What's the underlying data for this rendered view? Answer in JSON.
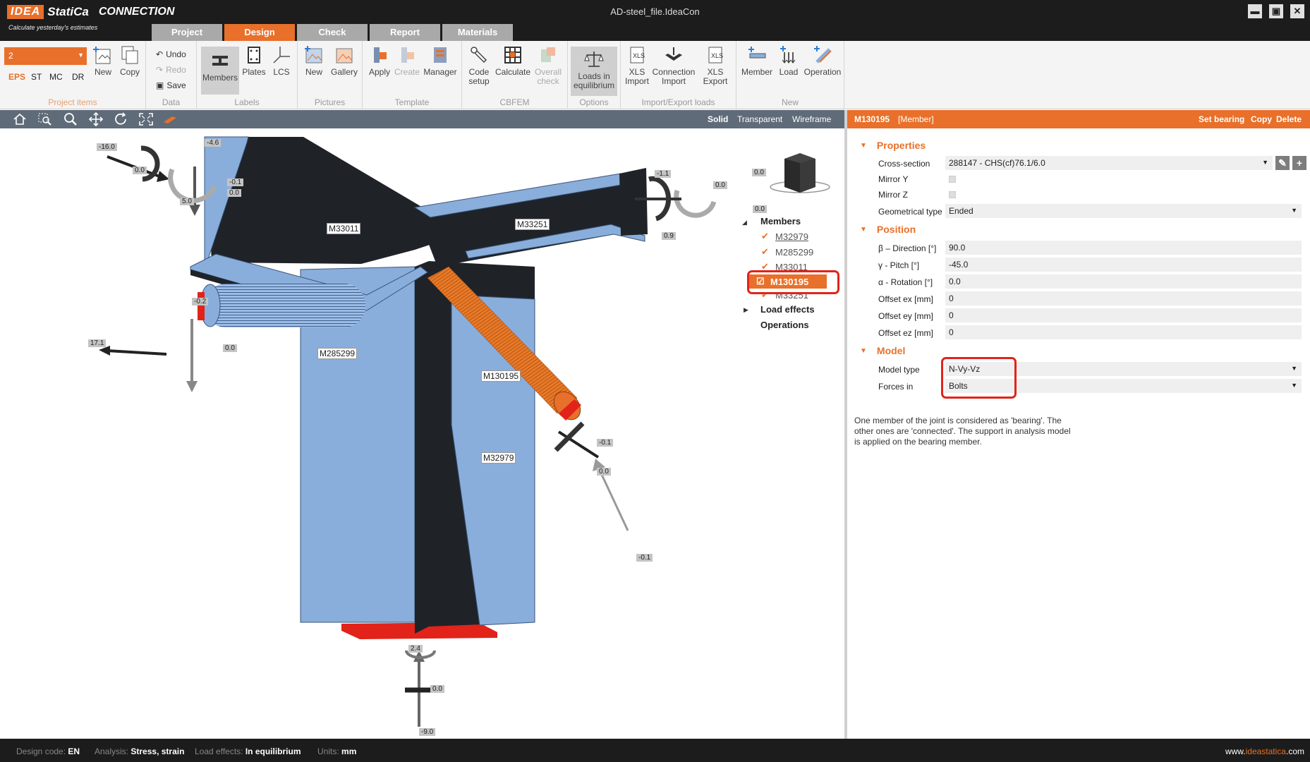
{
  "app": {
    "logo_text": "IDEA",
    "logo_name": "StatiCa",
    "product": "CONNECTION",
    "tagline": "Calculate yesterday's estimates",
    "window_title": "AD-steel_file.IdeaCon",
    "window_buttons": [
      "▬",
      "▣",
      "✕"
    ]
  },
  "main_tabs": [
    {
      "label": "Project",
      "active": false
    },
    {
      "label": "Design",
      "active": true
    },
    {
      "label": "Check",
      "active": false
    },
    {
      "label": "Report",
      "active": false
    },
    {
      "label": "Materials",
      "active": false
    }
  ],
  "ribbon": {
    "project_items": {
      "combo_value": "2",
      "types": [
        "EPS",
        "ST",
        "MC",
        "DR"
      ],
      "active_type": "EPS",
      "new_label": "New",
      "copy_label": "Copy",
      "group_label": "Project items"
    },
    "data": {
      "undo": "Undo",
      "redo": "Redo",
      "save": "Save",
      "group_label": "Data"
    },
    "labels": {
      "members": "Members",
      "plates": "Plates",
      "lcs": "LCS",
      "group_label": "Labels"
    },
    "pictures": {
      "new": "New",
      "gallery": "Gallery",
      "group_label": "Pictures"
    },
    "template": {
      "apply": "Apply",
      "create": "Create",
      "manager": "Manager",
      "group_label": "Template"
    },
    "cbfem": {
      "code_setup_1": "Code",
      "code_setup_2": "setup",
      "calculate": "Calculate",
      "overall_1": "Overall",
      "overall_2": "check",
      "group_label": "CBFEM"
    },
    "options": {
      "loads_1": "Loads in",
      "loads_2": "equilibrium",
      "group_label": "Options"
    },
    "import_export": {
      "xls_import_1": "XLS",
      "xls_import_2": "Import",
      "conn_import_1": "Connection",
      "conn_import_2": "Import",
      "xls_export_1": "XLS",
      "xls_export_2": "Export",
      "group_label": "Import/Export loads"
    },
    "new_group": {
      "member": "Member",
      "load": "Load",
      "operation": "Operation",
      "group_label": "New"
    }
  },
  "viewport": {
    "modes": [
      "Solid",
      "Transparent",
      "Wireframe"
    ],
    "active_mode": "Solid",
    "member_labels": [
      "M33011",
      "M33251",
      "M285299",
      "M130195",
      "M32979"
    ],
    "force_labels": [
      "-16.0",
      "-4.6",
      "0.0",
      "-0.1",
      "0.0",
      "5.0",
      "-1.1",
      "0.0",
      "0.0",
      "0.9",
      "-0.2",
      "17.1",
      "0.0",
      "-0.1",
      "0.0",
      "-0.1",
      "2.4",
      "0.0",
      "-9.0"
    ]
  },
  "tree": {
    "top_value": "0.0",
    "members_header": "Members",
    "members": [
      {
        "label": "M32979",
        "checked": true,
        "active": false
      },
      {
        "label": "M285299",
        "checked": true,
        "active": false
      },
      {
        "label": "M33011",
        "checked": true,
        "active": false
      },
      {
        "label": "M130195",
        "checked": true,
        "active": true
      },
      {
        "label": "M33251",
        "checked": true,
        "active": false
      }
    ],
    "load_effects": "Load effects",
    "operations": "Operations"
  },
  "panel": {
    "title": "M130195",
    "type": "[Member]",
    "actions": [
      "Set bearing",
      "Copy",
      "Delete"
    ],
    "properties": {
      "header": "Properties",
      "cross_section_label": "Cross-section",
      "cross_section_value": "288147 - CHS(cf)76.1/6.0",
      "mirror_y_label": "Mirror Y",
      "mirror_z_label": "Mirror Z",
      "geom_type_label": "Geometrical type",
      "geom_type_value": "Ended"
    },
    "position": {
      "header": "Position",
      "rows": [
        {
          "label": "β – Direction [°]",
          "value": "90.0"
        },
        {
          "label": "γ - Pitch [°]",
          "value": "-45.0"
        },
        {
          "label": "α - Rotation [°]",
          "value": "0.0"
        },
        {
          "label": "Offset ex [mm]",
          "value": "0"
        },
        {
          "label": "Offset ey [mm]",
          "value": "0"
        },
        {
          "label": "Offset ez [mm]",
          "value": "0"
        }
      ]
    },
    "model": {
      "header": "Model",
      "model_type_label": "Model type",
      "model_type_value": "N-Vy-Vz",
      "forces_in_label": "Forces in",
      "forces_in_value": "Bolts"
    },
    "hint": "One member of the joint is considered as 'bearing'. The other ones are 'connected'. The support in analysis model is applied on the bearing member."
  },
  "status": {
    "design_code_label": "Design code:",
    "design_code_value": "EN",
    "analysis_label": "Analysis:",
    "analysis_value": "Stress, strain",
    "load_effects_label": "Load effects:",
    "load_effects_value": "In equilibrium",
    "units_label": "Units:",
    "units_value": "mm",
    "web_prefix": "www.",
    "web_brand": "ideastatica",
    "web_suffix": ".com"
  },
  "colors": {
    "accent": "#e8702a",
    "highlight_red": "#e2231a",
    "steel_blue": "#8aaedb",
    "steel_dark": "#1f2328"
  }
}
